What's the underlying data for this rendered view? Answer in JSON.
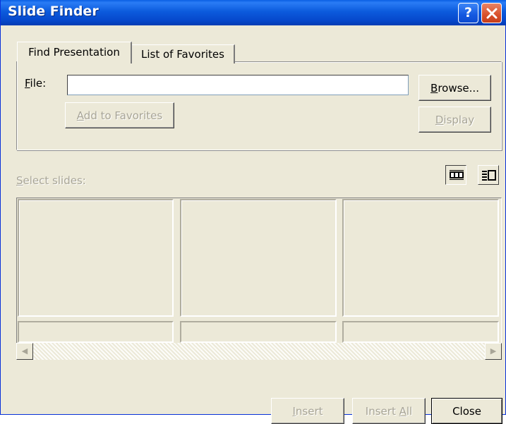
{
  "window": {
    "title": "Slide Finder",
    "help_glyph": "?"
  },
  "tabs": [
    {
      "label": "Find Presentation",
      "active": true
    },
    {
      "label": "List of Favorites",
      "active": false
    }
  ],
  "find": {
    "file_label_mnemonic": "F",
    "file_label_rest": "ile:",
    "file_value": "",
    "browse_mnemonic": "B",
    "browse_rest": "rowse...",
    "display_mnemonic": "D",
    "display_rest": "isplay",
    "add_fav_mnemonic": "A",
    "add_fav_rest": "dd to Favorites"
  },
  "slides": {
    "select_mnemonic": "S",
    "select_rest": "elect slides:",
    "view_modes": [
      "filmstrip-icon",
      "outline-list-icon"
    ],
    "selected_view": "filmstrip"
  },
  "footer": {
    "insert_mnemonic": "I",
    "insert_rest": "nsert",
    "insertall_pre": "Insert ",
    "insertall_mnemonic": "A",
    "insertall_rest": "ll",
    "close_label": "Close"
  },
  "colors": {
    "titlebar": "#0c5bdd",
    "dialog_bg": "#ece9d8",
    "disabled_text": "#a8a597"
  }
}
